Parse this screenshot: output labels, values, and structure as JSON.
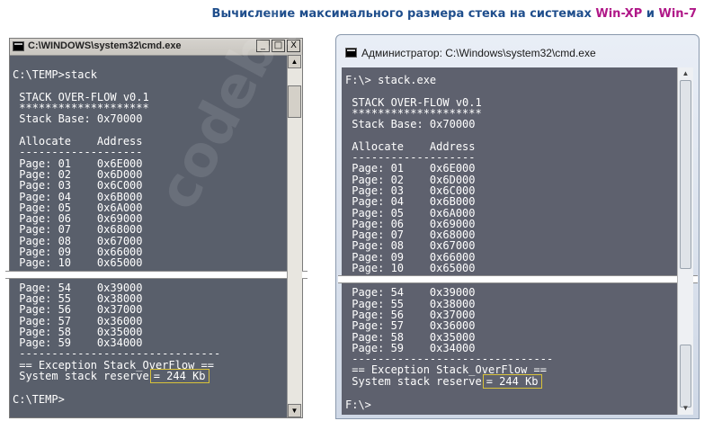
{
  "heading": {
    "text": "Вычисление максимального размера стека на системах ",
    "os1": "Win-XP",
    "and": " и ",
    "os2": "Win-7"
  },
  "watermark": "codeby.net",
  "xp_window": {
    "title": "C:\\WINDOWS\\system32\\cmd.exe",
    "min_glyph": "_",
    "max_glyph": "□",
    "close_glyph": "X",
    "lines_top": [
      "",
      "C:\\TEMP>stack",
      "",
      " STACK OVER-FLOW v0.1",
      " ********************",
      " Stack Base: 0x70000",
      "",
      " Allocate    Address",
      " -------------------",
      " Page: 01    0x6E000",
      " Page: 02    0x6D000",
      " Page: 03    0x6C000",
      " Page: 04    0x6B000",
      " Page: 05    0x6A000",
      " Page: 06    0x69000",
      " Page: 07    0x68000",
      " Page: 08    0x67000",
      " Page: 09    0x66000",
      " Page: 10    0x65000"
    ],
    "lines_bottom": [
      " Page: 54    0x39000",
      " Page: 55    0x38000",
      " Page: 56    0x37000",
      " Page: 57    0x36000",
      " Page: 58    0x35000",
      " Page: 59    0x34000",
      " -------------------------------",
      " == Exception Stack_OverFlow =="
    ],
    "reserve_label": " System stack reserve",
    "reserve_value": "= 244 Kb",
    "prompt": "C:\\TEMP>"
  },
  "w7_window": {
    "title": "Администратор: C:\\Windows\\system32\\cmd.exe",
    "min_glyph": "▁",
    "max_glyph": "▭",
    "close_glyph": "✕",
    "lines_top": [
      "F:\\> stack.exe",
      "",
      " STACK OVER-FLOW v0.1",
      " ********************",
      " Stack Base: 0x70000",
      "",
      " Allocate    Address",
      " -------------------",
      " Page: 01    0x6E000",
      " Page: 02    0x6D000",
      " Page: 03    0x6C000",
      " Page: 04    0x6B000",
      " Page: 05    0x6A000",
      " Page: 06    0x69000",
      " Page: 07    0x68000",
      " Page: 08    0x67000",
      " Page: 09    0x66000",
      " Page: 10    0x65000"
    ],
    "lines_bottom": [
      " Page: 54    0x39000",
      " Page: 55    0x38000",
      " Page: 56    0x37000",
      " Page: 57    0x36000",
      " Page: 58    0x35000",
      " Page: 59    0x34000",
      " -------------------------------",
      " == Exception Stack_OverFlow =="
    ],
    "reserve_label": " System stack reserve",
    "reserve_value": "= 244 Kb",
    "prompt": "F:\\>"
  },
  "colors": {
    "heading_blue": "#1f4e8c",
    "heading_magenta": "#b01888",
    "xp_console_bg": "#595f6b",
    "w7_console_bg": "#5e616e",
    "highlight_box": "#d8c23a"
  }
}
